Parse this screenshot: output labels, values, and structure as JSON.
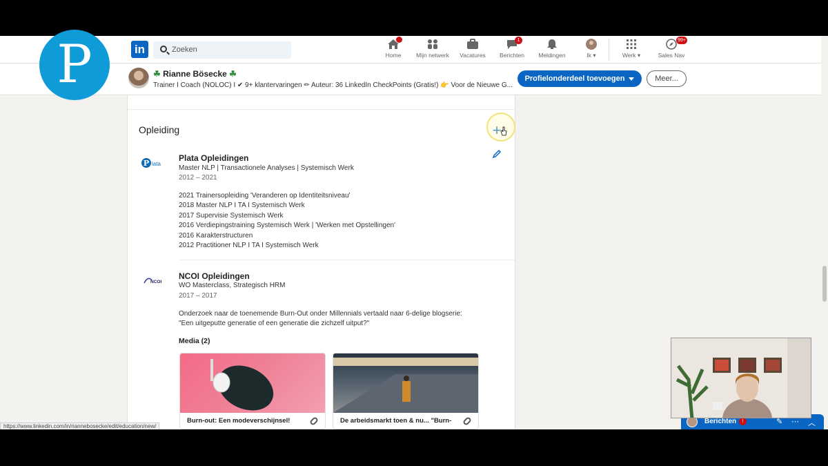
{
  "nav": {
    "search_placeholder": "Zoeken",
    "items": [
      {
        "label": "Home",
        "badge": "",
        "icon": "home-icon"
      },
      {
        "label": "Mijn netwerk",
        "badge": "",
        "icon": "network-icon"
      },
      {
        "label": "Vacatures",
        "badge": "",
        "icon": "briefcase-icon"
      },
      {
        "label": "Berichten",
        "badge": "1",
        "icon": "messaging-icon"
      },
      {
        "label": "Meldingen",
        "badge": "",
        "icon": "bell-icon"
      },
      {
        "label": "Ik",
        "badge": "",
        "icon": "avatar-icon"
      },
      {
        "label": "Werk",
        "badge": "",
        "icon": "grid-icon"
      },
      {
        "label": "Sales Nav",
        "badge": "99+",
        "icon": "compass-icon"
      }
    ]
  },
  "profile": {
    "name": "Rianne Bösecke",
    "headline": "Trainer I Coach (NOLOC) I ✔ 9+ klantervaringen ✏ Auteur: 36 LinkedIn CheckPoints (Gratis!) 👉 Voor de Nieuwe G...",
    "primary_button": "Profielonderdeel toevoegen",
    "more_button": "Meer..."
  },
  "education": {
    "title": "Opleiding",
    "entries": [
      {
        "logo_text": "Plata",
        "school": "Plata Opleidingen",
        "degree": "Master NLP | Transactionele Analyses | Systemisch Werk",
        "dates": "2012 – 2021",
        "description": [
          "2021 Trainersopleiding 'Veranderen op Identiteitsniveau'",
          "2018 Master NLP I TA I Systemisch Werk",
          "2017 Supervisie Systemisch Werk",
          "2016 Verdiepingstraining Systemisch Werk | 'Werken met Opstellingen'",
          "2016 Karakterstructuren",
          "2012 Practitioner NLP I TA I Systemisch Werk"
        ]
      },
      {
        "logo_text": "NCOI",
        "school": "NCOI Opleidingen",
        "degree": "WO Masterclass, Strategisch HRM",
        "dates": "2017 – 2017",
        "description": [
          "Onderzoek naar de toenemende Burn-Out onder Millennials vertaald naar 6-delige blogserie:",
          "\"Een uitgeputte generatie of een generatie die zichzelf uitput?\""
        ]
      }
    ],
    "media_title": "Media (2)",
    "media": [
      {
        "caption": "Burn-out: Een modeverschijnsel!"
      },
      {
        "caption": "De arbeidsmarkt toen & nu... \"Burn-"
      }
    ]
  },
  "status_url": "https://www.linkedin.com/in/riannebosecke/edit/education/new/",
  "messaging": {
    "label": "Berichten",
    "badge": "!"
  },
  "overlay_logo": "P",
  "colors": {
    "linkedin_blue": "#0a66c2",
    "badge_red": "#cc1016",
    "logo_blue": "#0f9bd7"
  }
}
